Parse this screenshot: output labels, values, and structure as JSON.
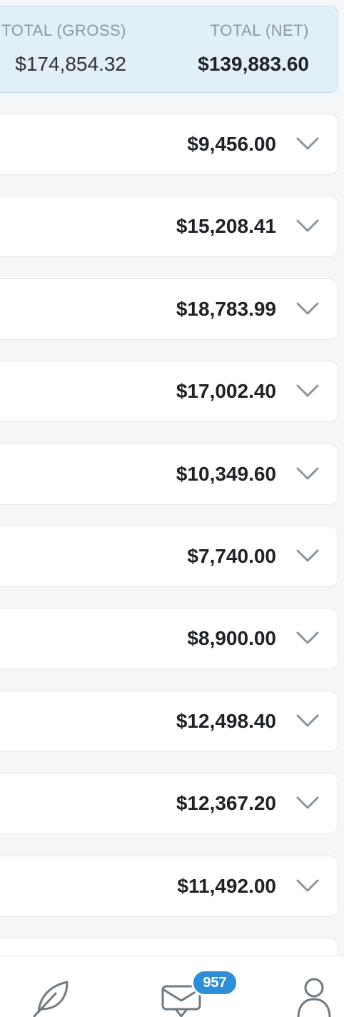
{
  "summary": {
    "gross_label": "TOTAL (GROSS)",
    "gross_value": "$174,854.32",
    "net_label": "TOTAL (NET)",
    "net_value": "$139,883.60"
  },
  "rows": [
    {
      "amount": "$9,456.00"
    },
    {
      "amount": "$15,208.41"
    },
    {
      "amount": "$18,783.99"
    },
    {
      "amount": "$17,002.40"
    },
    {
      "amount": "$10,349.60"
    },
    {
      "amount": "$7,740.00"
    },
    {
      "amount": "$8,900.00"
    },
    {
      "amount": "$12,498.40"
    },
    {
      "amount": "$12,367.20"
    },
    {
      "amount": "$11,492.00"
    },
    {
      "amount": ""
    }
  ],
  "bottom_nav": {
    "items": [
      {
        "icon": "leaf-icon"
      },
      {
        "icon": "messages-icon",
        "badge": "957"
      },
      {
        "icon": "user-icon"
      }
    ]
  },
  "colors": {
    "summary_background": "#e1eff9",
    "badge": "#2f8fd6",
    "icon_stroke": "#6f7a83"
  }
}
